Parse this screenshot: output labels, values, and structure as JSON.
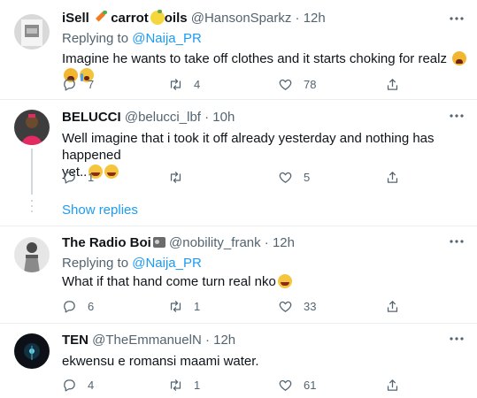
{
  "tweets": [
    {
      "name": "iSell",
      "name_suffix": "carrot",
      "name_suffix2": "oils",
      "handle": "@HansonSparkz",
      "dot": "·",
      "time": "12h",
      "replying_prefix": "Replying to",
      "replying_to": "@Naija_PR",
      "text": "Imagine he wants to take off clothes and it starts choking for realz",
      "replies": "7",
      "retweets": "4",
      "likes": "78"
    },
    {
      "name": "BELUCCI",
      "handle": "@belucci_lbf",
      "dot": "·",
      "time": "10h",
      "text_line1": "Well imagine that i took it off already yesterday and nothing has happened",
      "text_line2": "yet..",
      "replies": "1",
      "retweets": "",
      "likes": "5",
      "show_replies": "Show replies"
    },
    {
      "name": "The Radio Boi",
      "handle": "@nobility_frank",
      "dot": "·",
      "time": "12h",
      "replying_prefix": "Replying to",
      "replying_to": "@Naija_PR",
      "text": "What if that hand come turn real nko",
      "replies": "6",
      "retweets": "1",
      "likes": "33"
    },
    {
      "name": "TEN",
      "handle": "@TheEmmanuelN",
      "dot": "·",
      "time": "12h",
      "text": "ekwensu e romansi maami water.",
      "replies": "4",
      "retweets": "1",
      "likes": "61"
    }
  ],
  "colors": {
    "accent": "#1d9bf0",
    "secondary_text": "#536471",
    "divider": "#ebeef0"
  },
  "icons": [
    "reply-icon",
    "retweet-icon",
    "like-icon",
    "share-icon",
    "more-icon"
  ]
}
